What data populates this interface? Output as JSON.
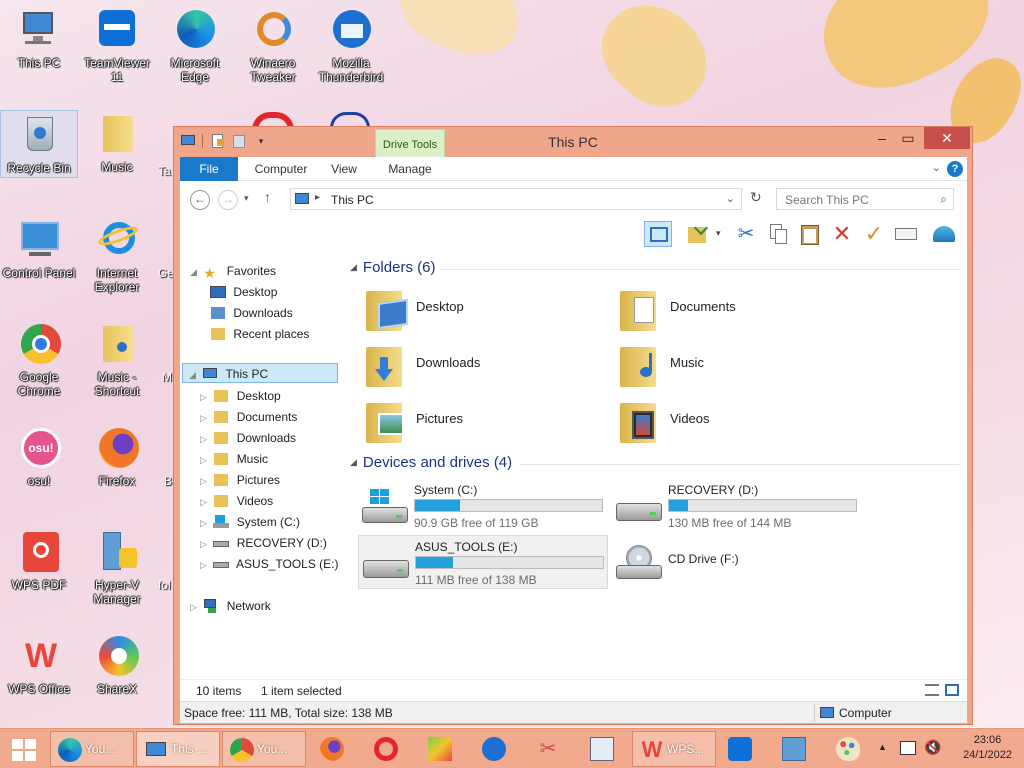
{
  "desktop": {
    "icons": [
      {
        "label": "This PC"
      },
      {
        "label": "TeamViewer 11"
      },
      {
        "label": "Microsoft Edge"
      },
      {
        "label": "Winaero Tweaker"
      },
      {
        "label": "Mozilla Thunderbird"
      },
      {
        "label": "Recycle Bin"
      },
      {
        "label": "Music"
      },
      {
        "label": "Control Panel"
      },
      {
        "label": "Internet Explorer"
      },
      {
        "label": "Google Chrome"
      },
      {
        "label": "Music - Shortcut"
      },
      {
        "label": "osu!"
      },
      {
        "label": "Firefox"
      },
      {
        "label": "WPS PDF"
      },
      {
        "label": "Hyper-V Manager"
      },
      {
        "label": "WPS Office"
      },
      {
        "label": "ShareX"
      }
    ],
    "partial_labels": [
      "Ta",
      "Ge",
      "M",
      "B",
      "fol"
    ]
  },
  "window": {
    "title": "This PC",
    "context_tab": "Drive Tools",
    "ribbon_tabs": [
      "File",
      "Computer",
      "View",
      "Manage"
    ],
    "address": "This PC",
    "search_placeholder": "Search This PC",
    "navigation": {
      "favorites": "Favorites",
      "favorite_items": [
        "Desktop",
        "Downloads",
        "Recent places"
      ],
      "this_pc": "This PC",
      "pc_items": [
        "Desktop",
        "Documents",
        "Downloads",
        "Music",
        "Pictures",
        "Videos",
        "System (C:)",
        "RECOVERY (D:)",
        "ASUS_TOOLS (E:)"
      ],
      "network": "Network"
    },
    "folders_header": "Folders (6)",
    "folders": [
      "Desktop",
      "Documents",
      "Downloads",
      "Music",
      "Pictures",
      "Videos"
    ],
    "devices_header": "Devices and drives (4)",
    "drives": [
      {
        "name": "System (C:)",
        "free": "90.9 GB free of 119 GB",
        "used_fraction": 0.24
      },
      {
        "name": "RECOVERY (D:)",
        "free": "130 MB free of 144 MB",
        "used_fraction": 0.1
      },
      {
        "name": "ASUS_TOOLS (E:)",
        "free": "111 MB free of 138 MB",
        "used_fraction": 0.2
      },
      {
        "name": "CD Drive (F:)",
        "free": "",
        "used_fraction": null
      }
    ],
    "status": {
      "items": "10 items",
      "selected": "1 item selected",
      "space": "Space free: 111 MB, Total size: 138 MB",
      "location": "Computer"
    }
  },
  "taskbar": {
    "buttons": [
      {
        "label": "You..."
      },
      {
        "label": "This ..."
      },
      {
        "label": "You..."
      },
      {
        "label": "WPS..."
      }
    ],
    "time": "23:06",
    "date": "24/1/2022"
  },
  "colors": {
    "accent": "#1979ca",
    "window_frame": "#f0a68a",
    "drive_bar": "#26a0da",
    "group_header": "#1e3287"
  }
}
